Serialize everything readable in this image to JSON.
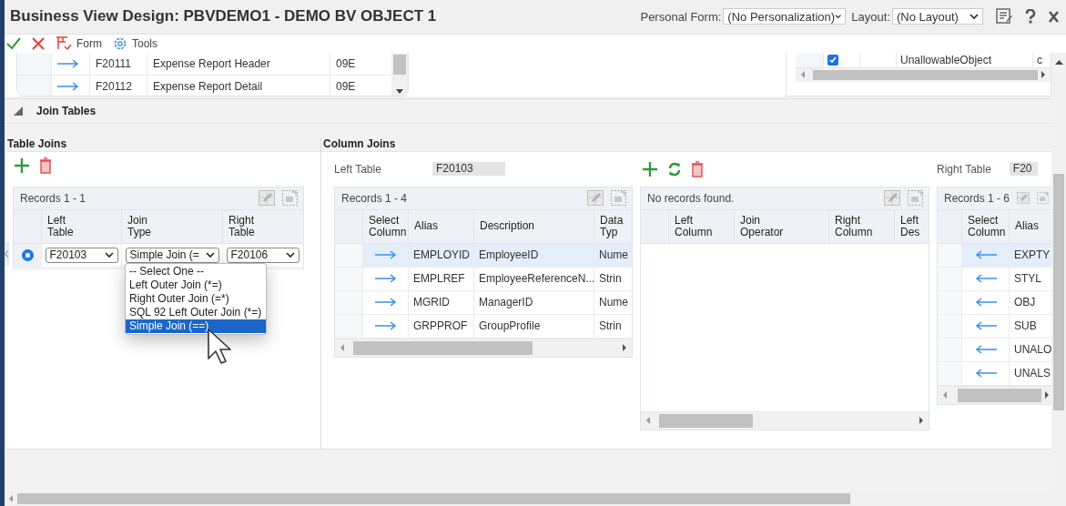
{
  "window": {
    "title": "Business View Design: PBVDEMO1 - DEMO BV OBJECT 1"
  },
  "header_controls": {
    "personal_form": {
      "label": "Personal Form:",
      "value": "(No Personalization)"
    },
    "layout": {
      "label": "Layout:",
      "value": "(No Layout)"
    }
  },
  "toolbar": {
    "menus": [
      {
        "label": "Form"
      },
      {
        "label": "Tools"
      }
    ]
  },
  "tables_grid": {
    "rows": [
      {
        "cells": [
          "F20111",
          "Expense Report Header",
          "09E"
        ]
      },
      {
        "cells": [
          "F20112",
          "Expense Report Detail",
          "09E"
        ]
      }
    ]
  },
  "fields_grid": {
    "rows": [
      {
        "checked": true,
        "cells": [
          "UnallowableObject",
          "c"
        ]
      }
    ]
  },
  "join_tables": {
    "title": "Join Tables",
    "expanded": true
  },
  "table_joins": {
    "title": "Table Joins",
    "records": "Records 1 - 1",
    "columns": [
      "Left Table",
      "Join Type",
      "Right Table"
    ],
    "rows": [
      {
        "selected": true,
        "left_table": "F20103",
        "join_type": "Simple Join (=",
        "right_table": "F20106"
      }
    ],
    "join_type_menu": {
      "options": [
        {
          "label": "-- Select One --",
          "selected": false
        },
        {
          "label": "Left Outer Join (*=)",
          "selected": false
        },
        {
          "label": "Right Outer Join (=*)",
          "selected": false
        },
        {
          "label": "SQL 92 Left Outer Join (*=)",
          "selected": false
        },
        {
          "label": "Simple Join (==)",
          "selected": true
        }
      ]
    }
  },
  "column_joins": {
    "title": "Column Joins",
    "left_table": {
      "label": "Left Table",
      "value": "F20103"
    },
    "left_grid": {
      "records": "Records 1 - 4",
      "select_column_header": "Select Column",
      "columns": [
        "Alias",
        "Description",
        "Data Typ"
      ],
      "rows": [
        {
          "selected": true,
          "cells": [
            "EMPLOYID",
            "EmployeeID",
            "Nume"
          ]
        },
        {
          "selected": false,
          "cells": [
            "EMPLREF",
            "EmployeeReferenceN...",
            "Strin"
          ]
        },
        {
          "selected": false,
          "cells": [
            "MGRID",
            "ManagerID",
            "Nume"
          ]
        },
        {
          "selected": false,
          "cells": [
            "GRPPROF",
            "GroupProfile",
            "Strin"
          ]
        }
      ]
    },
    "join_grid": {
      "records": "No records found.",
      "columns": [
        "Left Column",
        "Join Operator",
        "Right Column",
        "Left Des"
      ]
    },
    "right_table": {
      "label": "Right Table",
      "value": "F20"
    },
    "right_grid": {
      "records": "Records 1 - 6",
      "select_column_header": "Select Column",
      "columns": [
        "Alias"
      ],
      "rows": [
        {
          "selected": true,
          "cells": [
            "EXPTY"
          ]
        },
        {
          "selected": false,
          "cells": [
            "STYL"
          ]
        },
        {
          "selected": false,
          "cells": [
            "OBJ"
          ]
        },
        {
          "selected": false,
          "cells": [
            "SUB"
          ]
        },
        {
          "selected": false,
          "cells": [
            "UNALO"
          ]
        },
        {
          "selected": false,
          "cells": [
            "UNALS"
          ]
        }
      ]
    }
  }
}
